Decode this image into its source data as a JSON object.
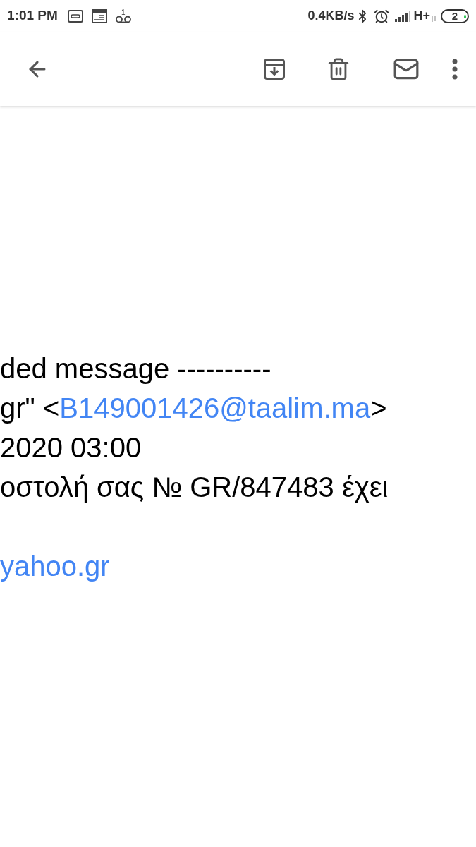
{
  "status_bar": {
    "time": "1:01 PM",
    "voicemail_count": "1",
    "speed": "0.4KB/s",
    "network": "H+",
    "battery": "2"
  },
  "message_lines": [
    {
      "kind": "text",
      "text": "ded message ----------"
    },
    {
      "kind": "address",
      "before": "gr\" <",
      "link": "B149001426@taalim.ma",
      "after": ">"
    },
    {
      "kind": "text",
      "text": "2020 03:00"
    },
    {
      "kind": "text",
      "text": "οστολή σας № GR/847483 έχει"
    },
    {
      "kind": "blank"
    },
    {
      "kind": "link",
      "text": "yahoo.gr"
    }
  ]
}
